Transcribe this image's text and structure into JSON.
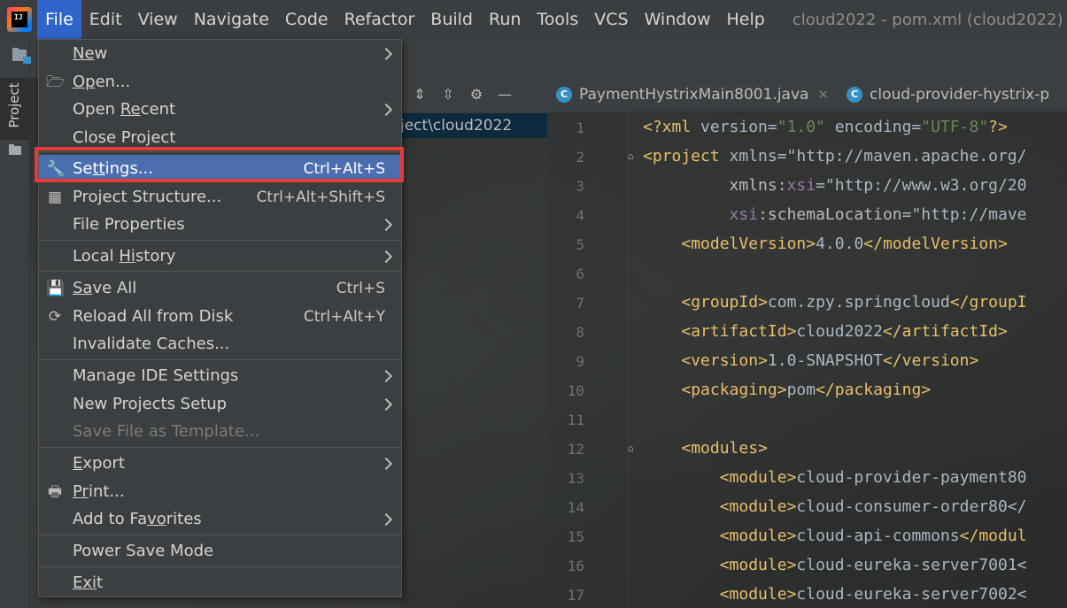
{
  "window": {
    "title": "cloud2022 - pom.xml (cloud2022)"
  },
  "menubar": {
    "items": [
      "File",
      "Edit",
      "View",
      "Navigate",
      "Code",
      "Refactor",
      "Build",
      "Run",
      "Tools",
      "VCS",
      "Window",
      "Help"
    ]
  },
  "toolstrip": {
    "project_tab": "Project"
  },
  "project_panel": {
    "path_fragment": "ject\\cloud2022"
  },
  "editor": {
    "tabs": [
      {
        "label": "PaymentHystrixMain8001.java",
        "icon": "java-class-icon"
      },
      {
        "label": "cloud-provider-hystrix-p",
        "icon": "c-icon"
      }
    ],
    "line_numbers": [
      "1",
      "2",
      "3",
      "4",
      "5",
      "6",
      "7",
      "8",
      "9",
      "10",
      "11",
      "12",
      "13",
      "14",
      "15",
      "16",
      "17"
    ],
    "lines": [
      "<?xml version=\"1.0\" encoding=\"UTF-8\"?>",
      "<project xmlns=\"http://maven.apache.org/",
      "         xmlns:xsi=\"http://www.w3.org/20",
      "         xsi:schemaLocation=\"http://mave",
      "    <modelVersion>4.0.0</modelVersion>",
      "",
      "    <groupId>com.zpy.springcloud</groupI",
      "    <artifactId>cloud2022</artifactId>",
      "    <version>1.0-SNAPSHOT</version>",
      "    <packaging>pom</packaging>",
      "",
      "    <modules>",
      "        <module>cloud-provider-payment80",
      "        <module>cloud-consumer-order80</",
      "        <module>cloud-api-commons</modul",
      "        <module>cloud-eureka-server7001<",
      "        <module>cloud-eureka-server7002<"
    ]
  },
  "file_menu": {
    "items": [
      {
        "label": "New",
        "submenu": true
      },
      {
        "label": "Open...",
        "icon": "folder-open-icon"
      },
      {
        "label": "Open Recent",
        "submenu": true
      },
      {
        "label": "Close Project"
      },
      {
        "label": "Settings...",
        "shortcut": "Ctrl+Alt+S",
        "icon": "wrench-icon",
        "selected": true
      },
      {
        "label": "Project Structure...",
        "shortcut": "Ctrl+Alt+Shift+S",
        "icon": "project-structure-icon"
      },
      {
        "label": "File Properties",
        "submenu": true
      },
      {
        "label": "Local History",
        "submenu": true
      },
      {
        "label": "Save All",
        "shortcut": "Ctrl+S",
        "icon": "save-icon"
      },
      {
        "label": "Reload All from Disk",
        "shortcut": "Ctrl+Alt+Y",
        "icon": "reload-icon"
      },
      {
        "label": "Invalidate Caches..."
      },
      {
        "label": "Manage IDE Settings",
        "submenu": true
      },
      {
        "label": "New Projects Setup",
        "submenu": true
      },
      {
        "label": "Save File as Template...",
        "disabled": true
      },
      {
        "label": "Export",
        "submenu": true
      },
      {
        "label": "Print...",
        "icon": "print-icon"
      },
      {
        "label": "Add to Favorites",
        "submenu": true
      },
      {
        "label": "Power Save Mode"
      },
      {
        "label": "Exit"
      }
    ]
  },
  "colors": {
    "selected": "#4b6eaf",
    "highlight_border": "#e83a34",
    "menubar_active": "#2f65ca"
  }
}
